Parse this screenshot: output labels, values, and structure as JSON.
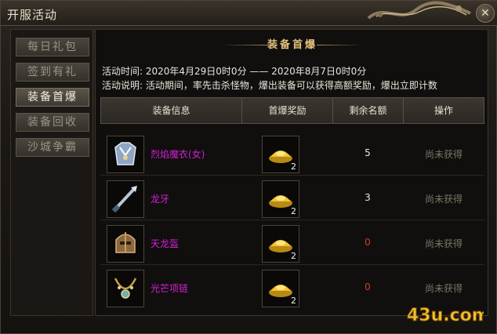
{
  "window": {
    "title": "开服活动",
    "close_symbol": "✕"
  },
  "sidebar": {
    "items": [
      {
        "label": "每日礼包",
        "active": false
      },
      {
        "label": "签到有礼",
        "active": false
      },
      {
        "label": "装备首爆",
        "active": true
      },
      {
        "label": "装备回收",
        "active": false
      },
      {
        "label": "沙城争霸",
        "active": false
      }
    ]
  },
  "panel": {
    "banner_title": "装备首爆",
    "activity_time": "活动时间: 2020年4月29日0时0分 —— 2020年8月7日0时0分",
    "activity_desc": "活动说明: 活动期间，率先击杀怪物，爆出装备可以获得高额奖励，爆出立即计数"
  },
  "table": {
    "headers": [
      "装备信息",
      "首爆奖励",
      "剩余名额",
      "操作"
    ],
    "rows": [
      {
        "item_name": "烈焰魔衣(女)",
        "item_icon": "armor-icon",
        "reward_count": "2",
        "reward_icon": "gold-ingot-icon",
        "remaining": "5",
        "action": "尚未获得"
      },
      {
        "item_name": "龙牙",
        "item_icon": "sword-icon",
        "reward_count": "2",
        "reward_icon": "gold-ingot-icon",
        "remaining": "3",
        "action": "尚未获得"
      },
      {
        "item_name": "天龙盔",
        "item_icon": "helmet-icon",
        "reward_count": "2",
        "reward_icon": "gold-ingot-icon",
        "remaining": "0",
        "action": "尚未获得"
      },
      {
        "item_name": "光芒项链",
        "item_icon": "necklace-icon",
        "reward_count": "2",
        "reward_icon": "gold-ingot-icon",
        "remaining": "0",
        "action": "尚未获得"
      }
    ]
  },
  "watermark": {
    "text": "43u.com"
  },
  "colors": {
    "item_name": "#d020d8",
    "remaining_zero": "#d23a2c",
    "banner_gold": "#e5c27a"
  }
}
